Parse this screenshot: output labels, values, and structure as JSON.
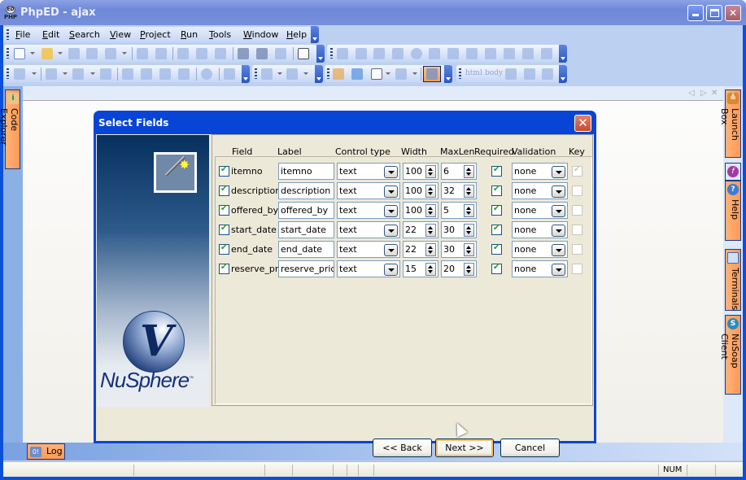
{
  "window": {
    "title": "PhpED - ajax",
    "controls": {
      "minimize": "minimize",
      "maximize": "maximize",
      "close": "✕"
    }
  },
  "menubar": {
    "items": [
      {
        "label": "File",
        "mnemonic": "F"
      },
      {
        "label": "Edit",
        "mnemonic": "E"
      },
      {
        "label": "Search",
        "mnemonic": "S"
      },
      {
        "label": "View",
        "mnemonic": "V"
      },
      {
        "label": "Project",
        "mnemonic": "P"
      },
      {
        "label": "Run",
        "mnemonic": "R"
      },
      {
        "label": "Tools",
        "mnemonic": "T"
      },
      {
        "label": "Window",
        "mnemonic": "W"
      },
      {
        "label": "Help",
        "mnemonic": "H"
      }
    ]
  },
  "toolbars": {
    "standard": [
      "new-file-icon",
      "open-folder-icon",
      "save-icon",
      "save-all-icon",
      "database-icon",
      "undo-icon",
      "redo-icon",
      "cut-icon",
      "copy-icon",
      "paste-icon",
      "find-icon",
      "find-next-icon",
      "replace-icon",
      "layout-icon"
    ],
    "forms": [
      "form-icon",
      "textbox-icon",
      "textarea-icon",
      "checkbox-icon",
      "radio-icon",
      "hidden-icon",
      "list-icon",
      "select-icon",
      "password-icon",
      "button-icon",
      "submit-icon",
      "reset-icon"
    ],
    "run": [
      "run-icon",
      "debug-icon",
      "profile-icon",
      "pause-icon",
      "step-into-icon",
      "step-over-icon",
      "step-out-icon",
      "run-to-cursor-icon",
      "stop-icon",
      "breakpoint-hand-icon"
    ],
    "nav": [
      "back-arrow-icon",
      "forward-arrow-icon"
    ],
    "tools": [
      "tools-icon",
      "deploy-icon",
      "paint-bucket-icon",
      "elephant-icon",
      "panel-toggle-icon"
    ],
    "html": {
      "html_label": "html",
      "body_label": "body",
      "icons": [
        "frames-icon",
        "image-icon",
        "link-icon"
      ]
    }
  },
  "side_tabs": {
    "left": [
      {
        "label": "Code Explorer",
        "icon": "code-explorer-icon"
      }
    ],
    "right": [
      {
        "label": "Launch Box",
        "icon": "launch-box-icon"
      },
      {
        "label": "Help",
        "icon": "help-icon"
      },
      {
        "label": "Terminals",
        "icon": "terminal-icon"
      },
      {
        "label": "NuSoap Client",
        "icon": "nusoap-icon"
      }
    ],
    "bottom": [
      {
        "label": "Log",
        "icon": "log-icon"
      }
    ]
  },
  "statusbar": {
    "num_indicator": "NUM"
  },
  "dialog": {
    "title": "Select Fields",
    "brand": "NuSphere",
    "trademark": "™",
    "columns": [
      "Field",
      "Label",
      "Control type",
      "Width",
      "MaxLen",
      "Required",
      "Validation",
      "Key"
    ],
    "rows": [
      {
        "selected": true,
        "field": "itemno",
        "label": "itemno",
        "control_type": "text",
        "width": "100",
        "maxlen": "6",
        "required": true,
        "validation": "none",
        "key": true,
        "key_disabled": true
      },
      {
        "selected": true,
        "field": "description",
        "label": "description",
        "control_type": "text",
        "width": "100",
        "maxlen": "32",
        "required": true,
        "validation": "none",
        "key": false,
        "key_disabled": true
      },
      {
        "selected": true,
        "field": "offered_by",
        "label": "offered_by",
        "control_type": "text",
        "width": "100",
        "maxlen": "5",
        "required": true,
        "validation": "none",
        "key": false,
        "key_disabled": true
      },
      {
        "selected": true,
        "field": "start_date",
        "label": "start_date",
        "control_type": "text",
        "width": "22",
        "maxlen": "30",
        "required": true,
        "validation": "none",
        "key": false,
        "key_disabled": true
      },
      {
        "selected": true,
        "field": "end_date",
        "label": "end_date",
        "control_type": "text",
        "width": "22",
        "maxlen": "30",
        "required": true,
        "validation": "none",
        "key": false,
        "key_disabled": true
      },
      {
        "selected": true,
        "field": "reserve_price",
        "label": "reserve_price",
        "control_type": "text",
        "width": "15",
        "maxlen": "20",
        "required": true,
        "validation": "none",
        "key": false,
        "key_disabled": true
      }
    ],
    "buttons": {
      "back": "<< Back",
      "next": "Next >>",
      "cancel": "Cancel"
    }
  }
}
